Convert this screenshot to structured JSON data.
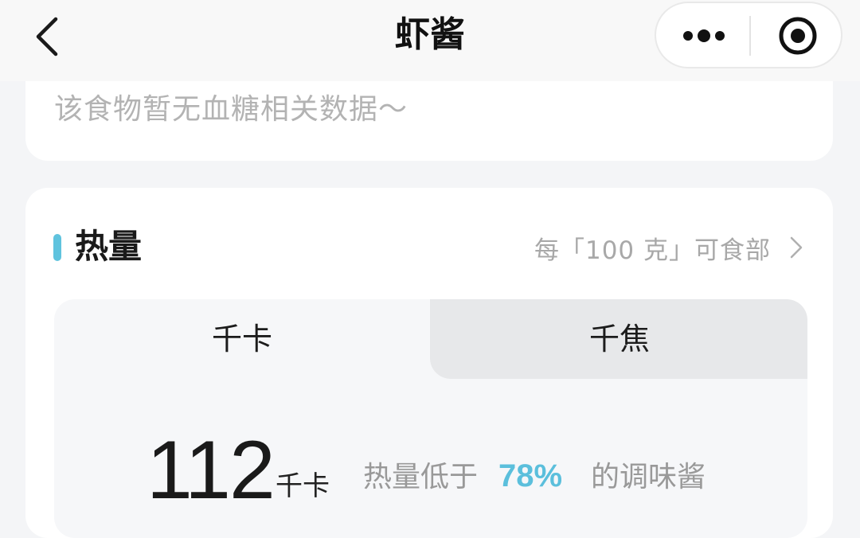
{
  "nav": {
    "title": "虾酱",
    "back_icon": "chevron-left-icon",
    "more_icon": "more-dots-icon",
    "close_icon": "target-close-icon"
  },
  "glycemic": {
    "empty_text": "该食物暂无血糖相关数据～"
  },
  "energy": {
    "title": "热量",
    "per_label": "每「100 克」可食部",
    "tabs": [
      {
        "label": "千卡",
        "selected": true
      },
      {
        "label": "千焦",
        "selected": false
      }
    ],
    "value": "112",
    "unit": "千卡",
    "compare_prefix": "热量低于",
    "compare_percent": "78%",
    "compare_suffix": "的调味酱"
  },
  "colors": {
    "accent": "#5fc3de",
    "percent": "#5bbfdc",
    "page_bg": "#f4f5f7",
    "card_bg": "#ffffff",
    "muted_text": "#b3b3b3"
  }
}
